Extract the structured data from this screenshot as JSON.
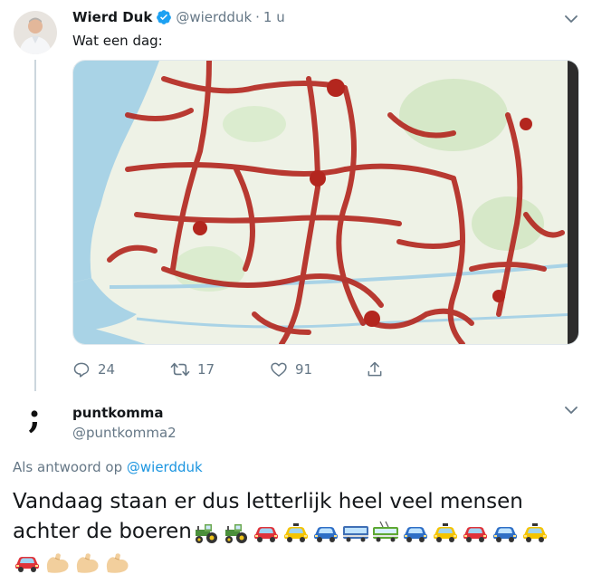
{
  "tweet": {
    "author_name": "Wierd Duk",
    "author_handle": "@wierdduk",
    "separator": "·",
    "time": "1 u",
    "text": "Wat een dag:",
    "actions": {
      "reply_count": "24",
      "retweet_count": "17",
      "like_count": "91"
    },
    "image_description_icon": "traffic-map-image"
  },
  "reply": {
    "author_name": "puntkomma",
    "author_handle": "@puntkomma2",
    "avatar_glyph": ";",
    "reply_prefix": "Als antwoord op",
    "reply_to": "@wierdduk",
    "text_line1": "Vandaag staan er dus letterlijk heel veel mensen",
    "text_line2": "achter de boeren",
    "emojis": [
      "tractor",
      "tractor",
      "red-car",
      "taxi",
      "blue-car",
      "bus",
      "trolleybus",
      "blue-car",
      "taxi",
      "red-car",
      "blue-car",
      "taxi",
      "red-car",
      "flexed-biceps",
      "flexed-biceps",
      "flexed-biceps"
    ]
  },
  "colors": {
    "accent": "#1b95e0",
    "secondary_text": "#657786",
    "thread_line": "#ccd6dd",
    "verified": "#1da1f2"
  }
}
